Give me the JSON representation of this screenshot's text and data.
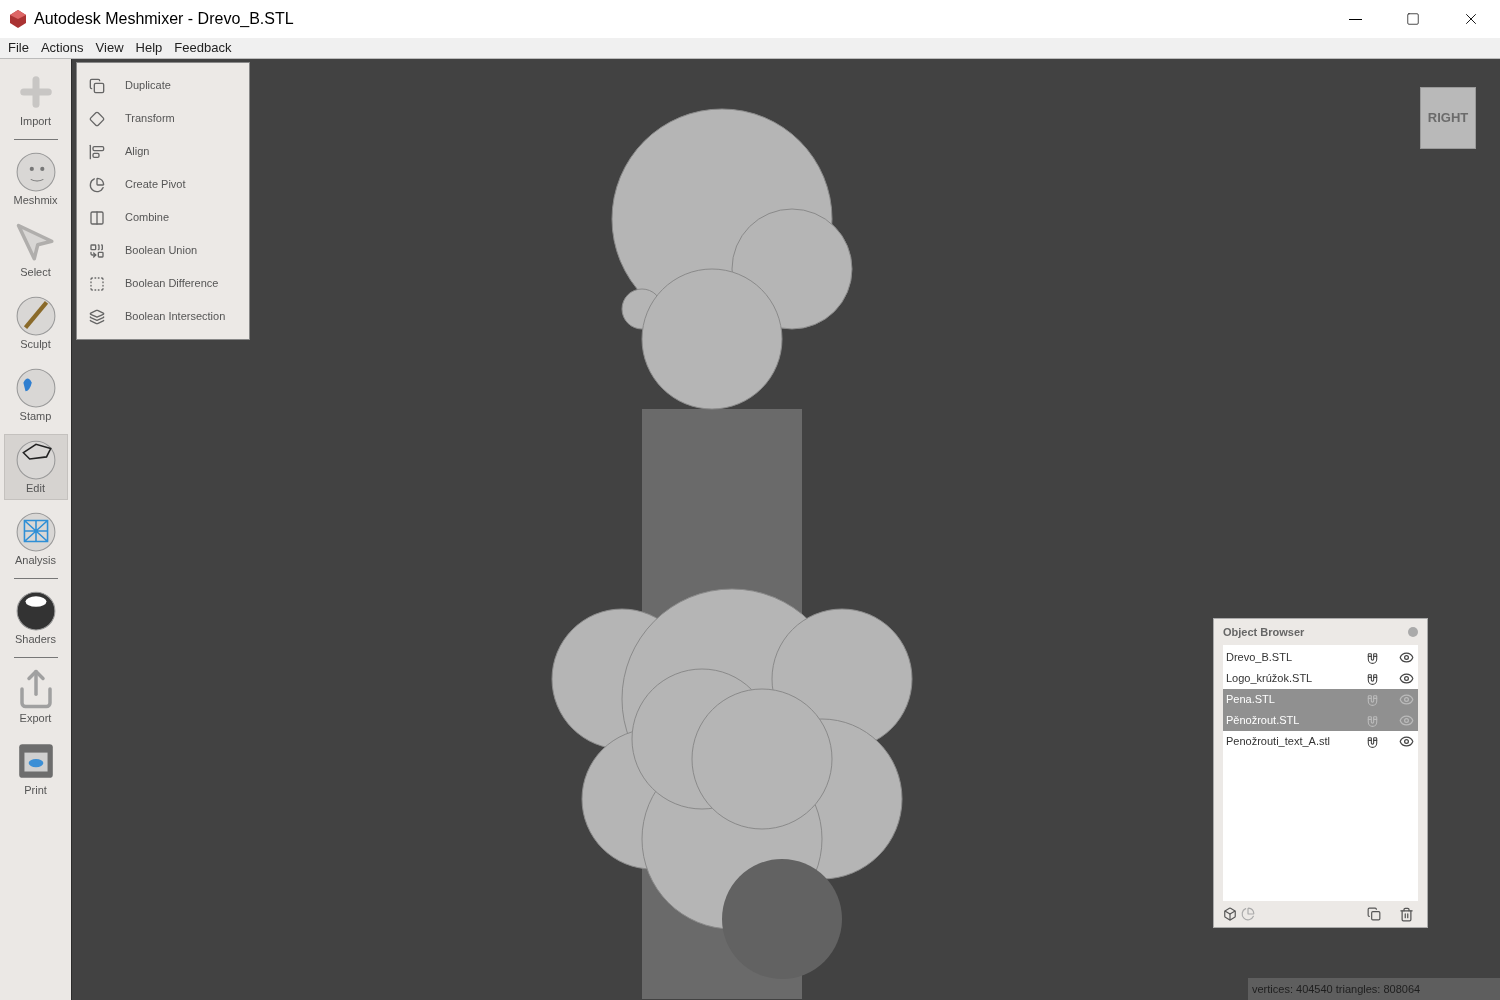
{
  "window": {
    "title": "Autodesk Meshmixer - Drevo_B.STL"
  },
  "menu": [
    "File",
    "Actions",
    "View",
    "Help",
    "Feedback"
  ],
  "toolbar": [
    {
      "label": "Import",
      "selected": false,
      "separator_after": true
    },
    {
      "label": "Meshmix",
      "selected": false,
      "separator_after": false
    },
    {
      "label": "Select",
      "selected": false,
      "separator_after": false
    },
    {
      "label": "Sculpt",
      "selected": false,
      "separator_after": false
    },
    {
      "label": "Stamp",
      "selected": false,
      "separator_after": false
    },
    {
      "label": "Edit",
      "selected": true,
      "separator_after": false
    },
    {
      "label": "Analysis",
      "selected": false,
      "separator_after": true
    },
    {
      "label": "Shaders",
      "selected": false,
      "separator_after": true
    },
    {
      "label": "Export",
      "selected": false,
      "separator_after": false
    },
    {
      "label": "Print",
      "selected": false,
      "separator_after": false
    }
  ],
  "edit_menu": [
    "Duplicate",
    "Transform",
    "Align",
    "Create Pivot",
    "Combine",
    "Boolean Union",
    "Boolean Difference",
    "Boolean Intersection"
  ],
  "view_cube": {
    "label": "RIGHT"
  },
  "object_browser": {
    "title": "Object Browser",
    "objects": [
      {
        "name": "Drevo_B.STL",
        "selected": false
      },
      {
        "name": "Logo_krúžok.STL",
        "selected": false
      },
      {
        "name": "Pena.STL",
        "selected": true
      },
      {
        "name": "Pěnožrout.STL",
        "selected": true
      },
      {
        "name": "Penožrouti_text_A.stl",
        "selected": false
      }
    ]
  },
  "status_bar": "vertices: 404540 triangles: 808064"
}
